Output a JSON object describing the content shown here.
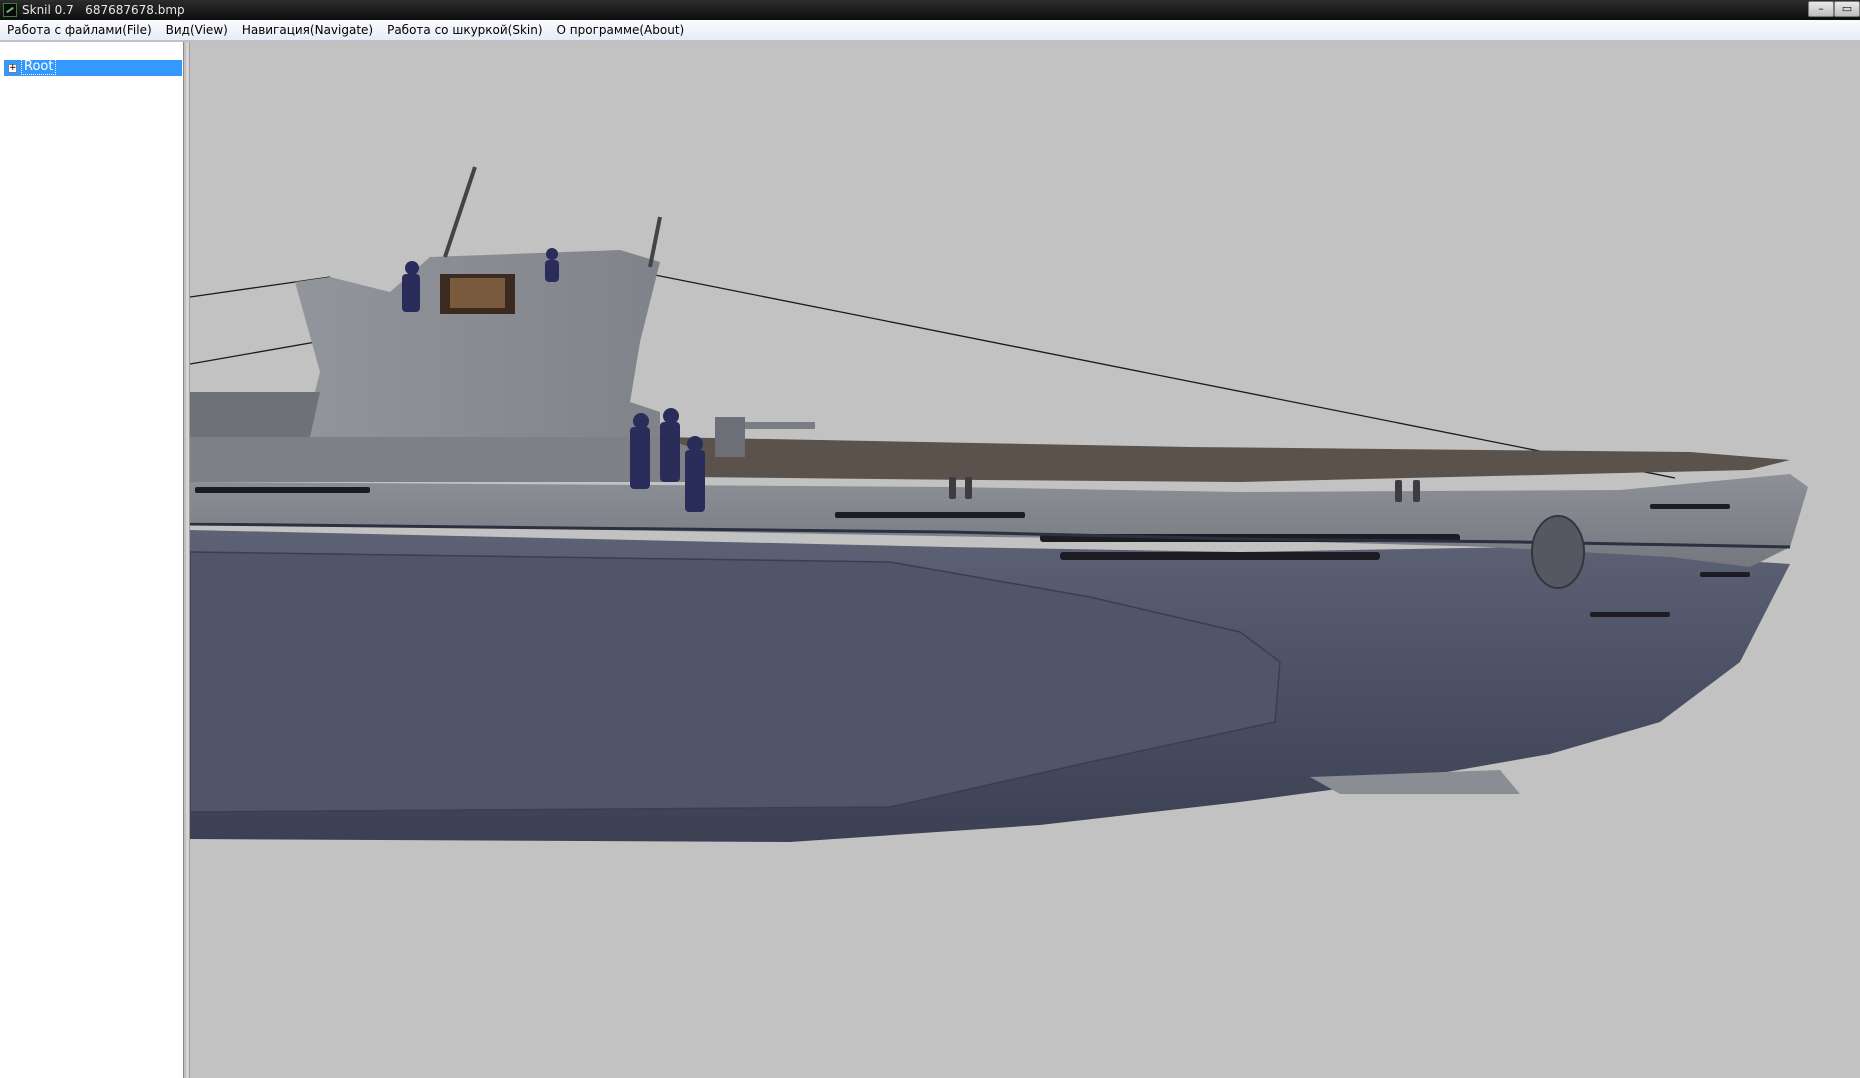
{
  "window": {
    "title": "Sknil 0.7   687687678.bmp",
    "minimize_glyph": "–",
    "maximize_glyph": "▭"
  },
  "menu": {
    "items": [
      "Работа с файлами(File)",
      "Вид(View)",
      "Навигация(Navigate)",
      "Работа со шкуркой(Skin)",
      "О программе(About)"
    ]
  },
  "tree": {
    "root_label": "Root",
    "expander_glyph": "+"
  },
  "viewport": {
    "background_color": "#c2c2c2",
    "model": "submarine-3d-model"
  }
}
